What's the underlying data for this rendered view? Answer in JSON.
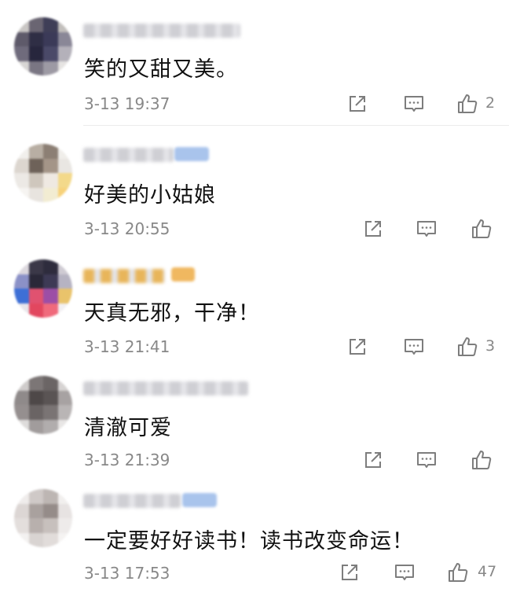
{
  "comments": [
    {
      "text": "笑的又甜又美。",
      "time": "3-13 19:37",
      "likes": "2",
      "icons": [
        "share-icon",
        "comment-icon",
        "thumbs-up-icon"
      ],
      "avatar_colors": [
        "#c9c6c4",
        "#6a6572",
        "#3f3e57",
        "#c2bfbc",
        "#5e5a6a",
        "#2f2e45",
        "#3b3a58",
        "#8a8797",
        "#6f6b7c",
        "#27263d",
        "#4a4968",
        "#b4b1ba",
        "#d8d6d4",
        "#7a7683",
        "#9d9aa4",
        "#e6e4e2"
      ],
      "name_color": "#cfcfd4",
      "badge_color": null
    },
    {
      "text": "好美的小姑娘",
      "time": "3-13 20:55",
      "likes": "",
      "icons": [
        "share-icon",
        "comment-icon",
        "thumbs-up-icon"
      ],
      "avatar_colors": [
        "#f1efec",
        "#b8aea3",
        "#8c7f74",
        "#f0eeea",
        "#dcd6cf",
        "#6e6259",
        "#a49588",
        "#e9e6e2",
        "#ece9e5",
        "#cfc7bd",
        "#efe9e2",
        "#f3d98a",
        "#f6f4f1",
        "#e8e4df",
        "#f2ecd2",
        "#f7d27a"
      ],
      "name_color": "#cfcfd4",
      "badge_color": "#a9c4ec"
    },
    {
      "text": "天真无邪，干净！",
      "time": "3-13 21:41",
      "likes": "3",
      "icons": [
        "share-icon",
        "comment-icon",
        "thumbs-up-icon"
      ],
      "avatar_colors": [
        "#dcd8de",
        "#3b3848",
        "#2e2c3d",
        "#cfcbd3",
        "#8b91c7",
        "#2a2838",
        "#3d3a55",
        "#b6b3c2",
        "#3d6fd6",
        "#e05270",
        "#9c4ea6",
        "#e9c36b",
        "#e8e6ea",
        "#e2475f",
        "#f06a7c",
        "#f2f0f3"
      ],
      "name_color": "#e8b55a",
      "badge_color": "#f0b860"
    },
    {
      "text": "清澈可爱",
      "time": "3-13 21:39",
      "likes": "",
      "icons": [
        "share-icon",
        "comment-icon",
        "thumbs-up-icon"
      ],
      "avatar_colors": [
        "#cfcccb",
        "#7c7676",
        "#6b6565",
        "#d6d3d2",
        "#8f8a8a",
        "#4e4848",
        "#5a5454",
        "#a7a2a2",
        "#958f8f",
        "#6a6464",
        "#7a7474",
        "#b9b5b5",
        "#dedcdb",
        "#a19c9c",
        "#b1adad",
        "#e8e6e5"
      ],
      "name_color": "#cfcfd4",
      "badge_color": null
    },
    {
      "text": "一定要好好读书！读书改变命运！",
      "time": "3-13 17:53",
      "likes": "47",
      "icons": [
        "share-icon",
        "comment-icon",
        "thumbs-up-icon"
      ],
      "avatar_colors": [
        "#efeceb",
        "#cfc9c7",
        "#bdb6b3",
        "#f1efee",
        "#dcd6d4",
        "#a9a19e",
        "#958c89",
        "#e7e3e2",
        "#e3dedc",
        "#b8b0ad",
        "#c7c0bd",
        "#eeebea",
        "#f3f1f0",
        "#d9d4d2",
        "#e1dcda",
        "#f5f3f2"
      ],
      "name_color": "#cfcfd4",
      "badge_color": "#a9c4ec"
    }
  ],
  "icon_color": "#7d7d7d"
}
